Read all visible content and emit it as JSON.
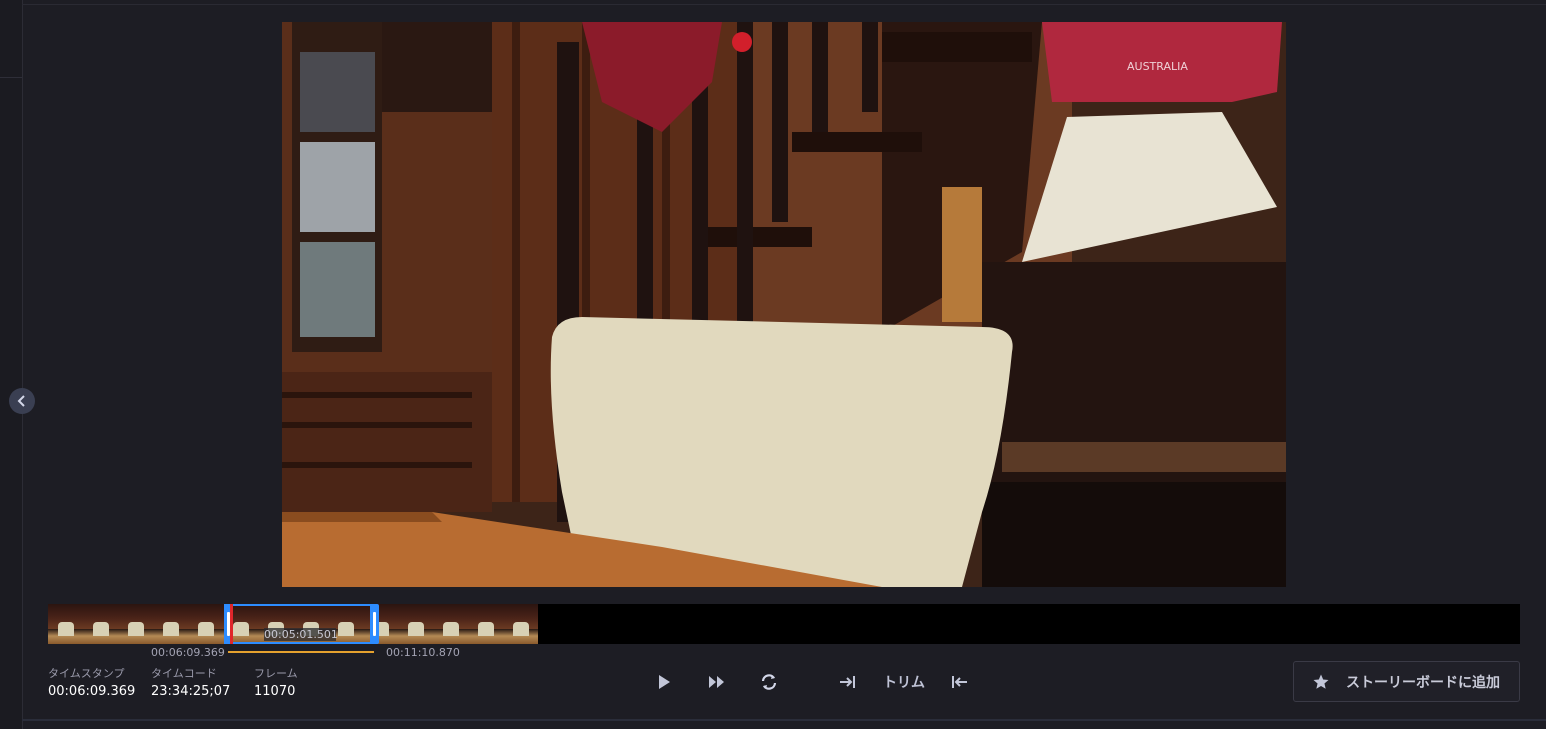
{
  "navigation": {
    "collapse_icon": "chevron-left-icon"
  },
  "player": {
    "accent": "#2d8cff",
    "playhead_color": "#e0262b",
    "range_color": "#e5a12e",
    "frame_text": "AUSTRALIA"
  },
  "timeline": {
    "selection_start": "00:06:09.369",
    "selection_end": "00:11:10.870",
    "selection_duration": "00:05:01.501"
  },
  "info": {
    "timestamp_label": "タイムスタンプ",
    "timestamp_value": "00:06:09.369",
    "timecode_label": "タイムコード",
    "timecode_value": "23:34:25;07",
    "frame_label": "フレーム",
    "frame_value": "11070"
  },
  "controls": {
    "play_icon": "play-icon",
    "fast_forward_icon": "fast-forward-icon",
    "loop_icon": "loop-icon",
    "set_in_icon": "set-in-point-icon",
    "trim_label": "トリム",
    "set_out_icon": "set-out-point-icon"
  },
  "storyboard": {
    "icon": "star-icon",
    "label": "ストーリーボードに追加"
  }
}
